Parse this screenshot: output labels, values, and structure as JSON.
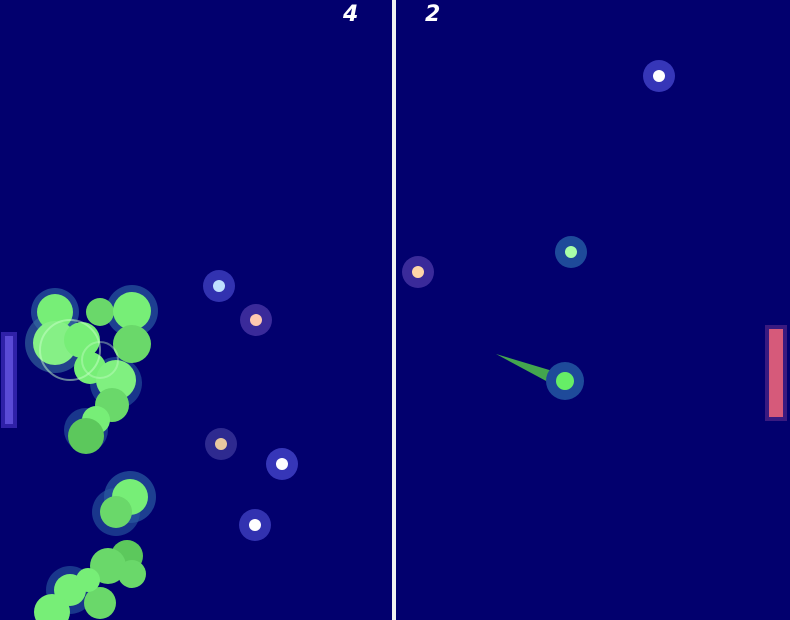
{
  "scores": {
    "left": "4",
    "right": "2"
  },
  "colors": {
    "background": "#02006e",
    "net": "#f2f2f2",
    "left_paddle": "#5a4ad6",
    "right_paddle": "#d65a7a",
    "ball": "#66ee66",
    "green_blob": "#77ee77"
  },
  "powerups": [
    {
      "name": "powerup-blue",
      "color": "#bfe0ff"
    },
    {
      "name": "powerup-peach",
      "color": "#ffc8b0"
    },
    {
      "name": "powerup-tan",
      "color": "#e8c8a0"
    },
    {
      "name": "powerup-white",
      "color": "#ffffff"
    },
    {
      "name": "powerup-white",
      "color": "#ffffff"
    },
    {
      "name": "powerup-white",
      "color": "#ffffff"
    },
    {
      "name": "powerup-peach",
      "color": "#ffd6a8"
    },
    {
      "name": "powerup-green",
      "color": "#a8ffa8"
    }
  ]
}
